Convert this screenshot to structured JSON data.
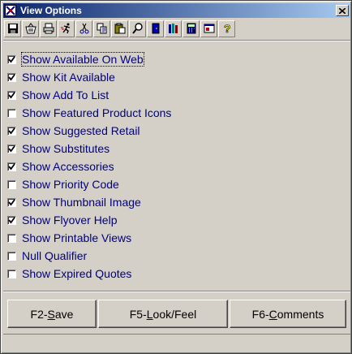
{
  "window": {
    "title": "View Options"
  },
  "toolbar": {
    "icons": [
      "save-icon",
      "basket-icon",
      "print-icon",
      "run-icon",
      "cut-icon",
      "copy-icon",
      "paste-icon",
      "find-icon",
      "exit-door-icon",
      "library-icon",
      "calculator-icon",
      "window-icon",
      "help-icon"
    ]
  },
  "options": [
    {
      "label": "Show Available On Web",
      "checked": true
    },
    {
      "label": "Show Kit Available",
      "checked": true
    },
    {
      "label": "Show Add To List",
      "checked": true
    },
    {
      "label": "Show Featured Product Icons",
      "checked": false
    },
    {
      "label": "Show Suggested Retail",
      "checked": true
    },
    {
      "label": "Show Substitutes",
      "checked": true
    },
    {
      "label": "Show Accessories",
      "checked": true
    },
    {
      "label": "Show Priority Code",
      "checked": false
    },
    {
      "label": "Show Thumbnail Image",
      "checked": true
    },
    {
      "label": "Show Flyover Help",
      "checked": true
    },
    {
      "label": "Show Printable Views",
      "checked": false
    },
    {
      "label": "Null Qualifier",
      "checked": false
    },
    {
      "label": "Show Expired Quotes",
      "checked": false
    }
  ],
  "buttons": {
    "save": {
      "prefix": "F2-",
      "key": "S",
      "rest": "ave"
    },
    "look": {
      "prefix": "F5-",
      "key": "L",
      "rest": "ook/Feel"
    },
    "comments": {
      "prefix": "F6-",
      "key": "C",
      "rest": "omments"
    }
  },
  "colors": {
    "title_start": "#0a246a",
    "title_end": "#a6caf0",
    "label": "#000080",
    "face": "#d4d0c8"
  }
}
